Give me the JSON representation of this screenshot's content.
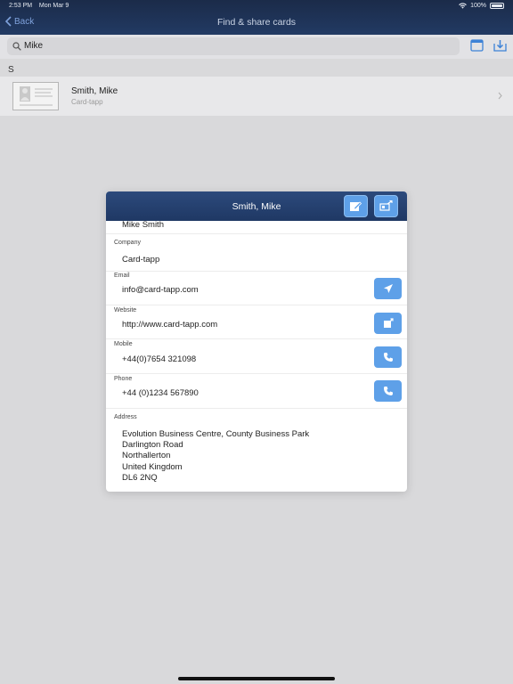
{
  "status": {
    "time": "2:53 PM",
    "date": "Mon Mar 9",
    "battery": "100%"
  },
  "nav": {
    "back_label": "Back",
    "title": "Find & share cards"
  },
  "search": {
    "value": "Mike"
  },
  "list": {
    "section": "S",
    "items": [
      {
        "name": "Smith, Mike",
        "subtitle": "Card-tapp"
      }
    ]
  },
  "modal": {
    "title": "Smith, Mike",
    "name_value": "Mike Smith",
    "fields": {
      "company": {
        "label": "Company",
        "value": "Card-tapp"
      },
      "email": {
        "label": "Email",
        "value": "info@card-tapp.com"
      },
      "website": {
        "label": "Website",
        "value": "http://www.card-tapp.com"
      },
      "mobile": {
        "label": "Mobile",
        "value": "+44(0)7654 321098"
      },
      "phone": {
        "label": "Phone",
        "value": "+44 (0)1234 567890"
      },
      "address": {
        "label": "Address",
        "lines": [
          "Evolution Business Centre, County Business Park",
          "Darlington Road",
          "Northallerton",
          "United Kingdom",
          "DL6 2NQ"
        ]
      }
    }
  },
  "colors": {
    "nav_bg": "#1f3864",
    "accent_button": "#5ea0e8",
    "back_link": "#7fa2dc"
  },
  "icons": [
    "chevron-left-icon",
    "search-icon",
    "wifi-icon",
    "battery-icon",
    "window-icon",
    "download-icon",
    "card-placeholder-icon",
    "chevron-right-icon",
    "edit-icon",
    "share-card-icon",
    "send-icon",
    "open-link-icon",
    "phone-icon"
  ]
}
